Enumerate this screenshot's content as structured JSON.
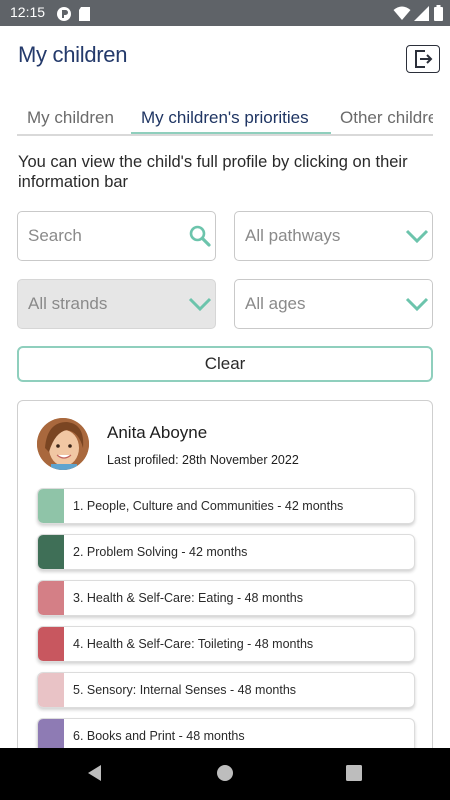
{
  "status_bar": {
    "time": "12:15"
  },
  "header": {
    "title": "My children"
  },
  "tabs": [
    {
      "label": "My children",
      "active": false
    },
    {
      "label": "My children's priorities",
      "active": true
    },
    {
      "label": "Other children",
      "active": false
    }
  ],
  "intro_text": "You can view the child's full profile by clicking on their information bar",
  "filters": {
    "search_placeholder": "Search",
    "pathways_value": "All pathways",
    "strands_value": "All strands",
    "ages_value": "All ages"
  },
  "clear_label": "Clear",
  "child": {
    "name": "Anita Aboyne",
    "last_profiled": "Last profiled: 28th November 2022",
    "priorities": [
      {
        "text": "1. People, Culture and Communities - 42 months",
        "color": "#8fc4a8"
      },
      {
        "text": "2. Problem Solving - 42 months",
        "color": "#3f6f57"
      },
      {
        "text": "3. Health & Self-Care: Eating - 48 months",
        "color": "#d47f86"
      },
      {
        "text": "4. Health & Self-Care: Toileting - 48 months",
        "color": "#c8575f"
      },
      {
        "text": "5. Sensory: Internal Senses - 48 months",
        "color": "#e9c3c6"
      },
      {
        "text": "6. Books and Print - 48 months",
        "color": "#8e7bb4"
      }
    ]
  },
  "colors": {
    "accent": "#8fcfbd",
    "title": "#243a6b",
    "status_bar": "#5f6368"
  }
}
